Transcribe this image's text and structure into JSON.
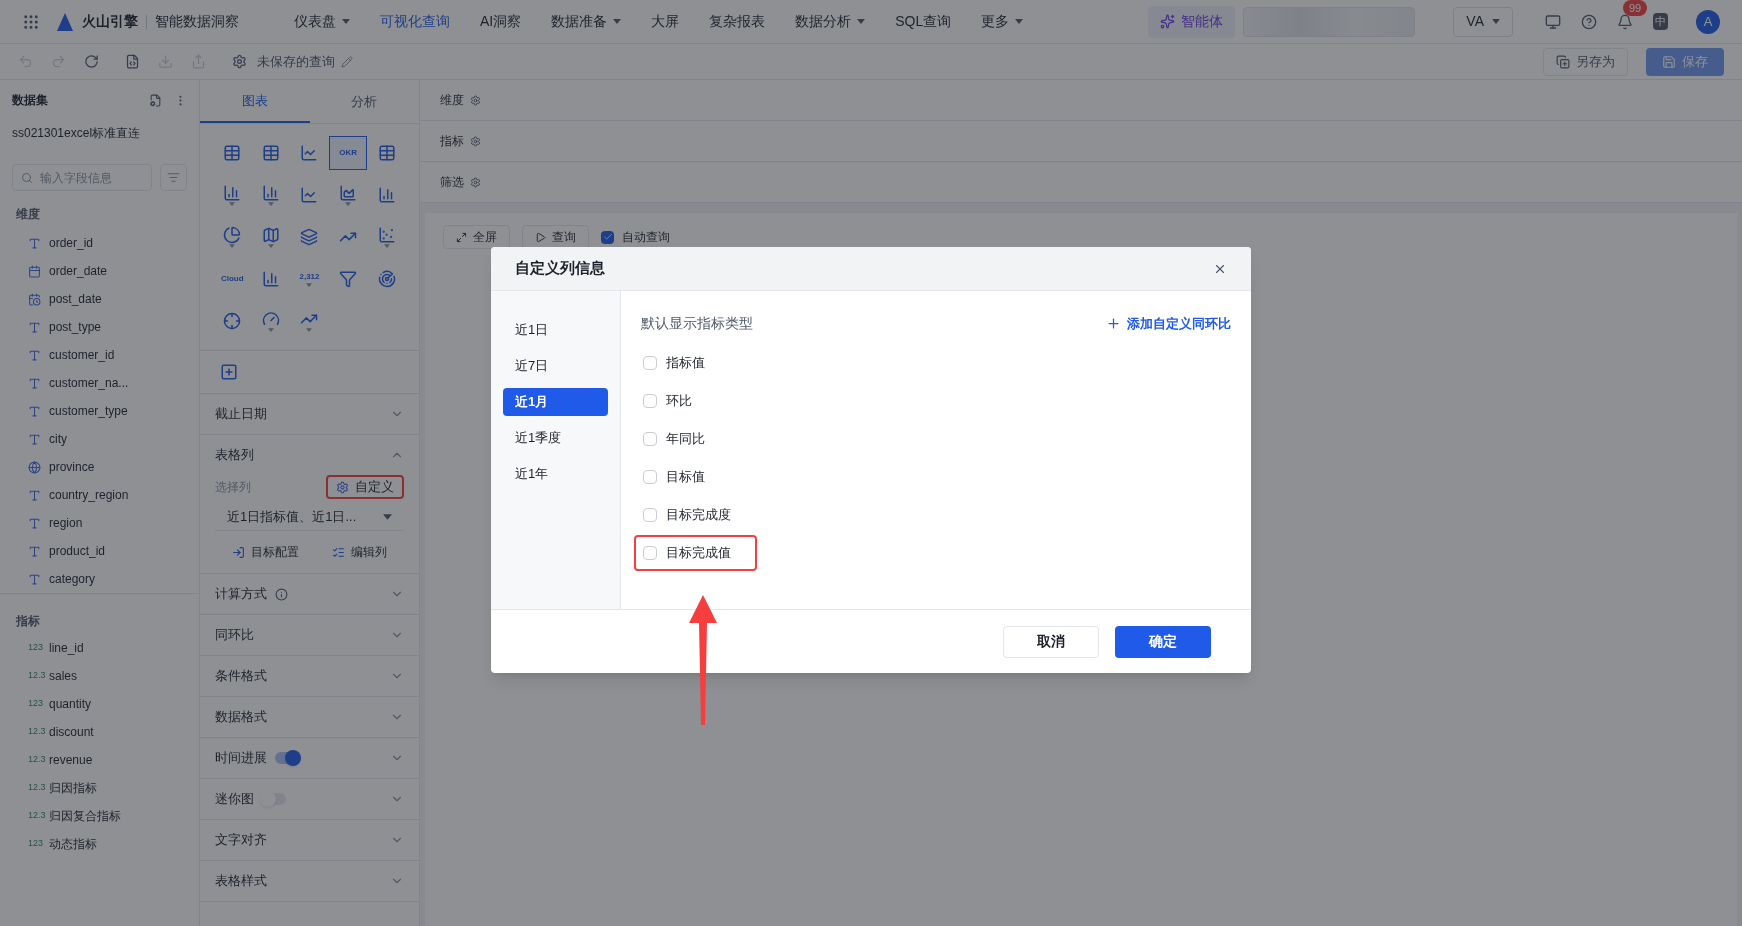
{
  "topbar": {
    "brand": "火山引擎",
    "product": "智能数据洞察",
    "nav": [
      {
        "label": "仪表盘",
        "dropdown": true,
        "selected": false
      },
      {
        "label": "可视化查询",
        "dropdown": false,
        "selected": true
      },
      {
        "label": "AI洞察",
        "dropdown": false,
        "selected": false
      },
      {
        "label": "数据准备",
        "dropdown": true,
        "selected": false
      },
      {
        "label": "大屏",
        "dropdown": false,
        "selected": false
      },
      {
        "label": "复杂报表",
        "dropdown": false,
        "selected": false
      },
      {
        "label": "数据分析",
        "dropdown": true,
        "selected": false
      },
      {
        "label": "SQL查询",
        "dropdown": false,
        "selected": false
      },
      {
        "label": "更多",
        "dropdown": true,
        "selected": false
      }
    ],
    "agent": "智能体",
    "user_menu": "VA",
    "badge": "99",
    "language": "中",
    "avatar": "A"
  },
  "toolbar": {
    "title": "未保存的查询",
    "save_as": "另存为",
    "save": "保存"
  },
  "dataset_panel": {
    "title": "数据集",
    "dataset": "ss021301excel标准直连",
    "search": {
      "placeholder": "输入字段信息"
    },
    "dimensions": {
      "title": "维度",
      "fields": [
        {
          "name": "order_id",
          "kind": "text"
        },
        {
          "name": "order_date",
          "kind": "date"
        },
        {
          "name": "post_date",
          "kind": "datetime"
        },
        {
          "name": "post_type",
          "kind": "text"
        },
        {
          "name": "customer_id",
          "kind": "text"
        },
        {
          "name": "customer_na...",
          "kind": "text"
        },
        {
          "name": "customer_type",
          "kind": "text"
        },
        {
          "name": "city",
          "kind": "text"
        },
        {
          "name": "province",
          "kind": "geo"
        },
        {
          "name": "country_region",
          "kind": "text"
        },
        {
          "name": "region",
          "kind": "text"
        },
        {
          "name": "product_id",
          "kind": "text"
        },
        {
          "name": "category",
          "kind": "text"
        }
      ]
    },
    "measures": {
      "title": "指标",
      "fields": [
        {
          "name": "line_id",
          "type": "123"
        },
        {
          "name": "sales",
          "type": "12.3"
        },
        {
          "name": "quantity",
          "type": "123"
        },
        {
          "name": "discount",
          "type": "12.3"
        },
        {
          "name": "revenue",
          "type": "12.3"
        },
        {
          "name": "归因指标",
          "type": "12.3"
        },
        {
          "name": "归因复合指标",
          "type": "12.3"
        },
        {
          "name": "动态指标",
          "type": "123"
        }
      ]
    }
  },
  "config_panel": {
    "tabs": [
      {
        "label": "图表",
        "selected": true
      },
      {
        "label": "分析",
        "selected": false
      }
    ],
    "chart_types": [
      {
        "selected": false,
        "menu": false
      },
      {
        "selected": false,
        "menu": false
      },
      {
        "selected": false,
        "menu": false
      },
      {
        "selected": true,
        "menu": false,
        "label": "OKR"
      },
      {
        "selected": false,
        "menu": false
      },
      {
        "selected": false,
        "menu": true
      },
      {
        "selected": false,
        "menu": true
      },
      {
        "selected": false,
        "menu": false
      },
      {
        "selected": false,
        "menu": true
      },
      {
        "selected": false,
        "menu": false
      },
      {
        "selected": false,
        "menu": true
      },
      {
        "selected": false,
        "menu": true
      },
      {
        "selected": false,
        "menu": false
      },
      {
        "selected": false,
        "menu": false
      },
      {
        "selected": false,
        "menu": true
      },
      {
        "selected": false,
        "menu": false,
        "label": "Cloud"
      },
      {
        "selected": false,
        "menu": false
      },
      {
        "selected": false,
        "menu": true,
        "label": "2,312"
      },
      {
        "selected": false,
        "menu": false
      },
      {
        "selected": false,
        "menu": false
      },
      {
        "selected": false,
        "menu": false
      },
      {
        "selected": false,
        "menu": true
      },
      {
        "selected": false,
        "menu": true
      }
    ],
    "sections": [
      {
        "kind": "plain",
        "title": "截止日期",
        "expanded": false
      },
      {
        "kind": "columns",
        "title": "表格列",
        "expanded": true,
        "field_label": "选择列",
        "custom_button": "自定义",
        "custom_highlighted": true,
        "select_value": "近1日指标值、近1日...",
        "target_button": "目标配置",
        "edit_button": "编辑列"
      },
      {
        "kind": "info",
        "title": "计算方式",
        "expanded": false
      },
      {
        "kind": "plain",
        "title": "同环比",
        "expanded": false
      },
      {
        "kind": "plain",
        "title": "条件格式",
        "expanded": false
      },
      {
        "kind": "plain",
        "title": "数据格式",
        "expanded": false
      },
      {
        "kind": "toggle",
        "title": "时间进展",
        "expanded": false,
        "on": true
      },
      {
        "kind": "toggle",
        "title": "迷你图",
        "expanded": false,
        "on": false
      },
      {
        "kind": "plain",
        "title": "文字对齐",
        "expanded": false
      },
      {
        "kind": "plain",
        "title": "表格样式",
        "expanded": false
      }
    ]
  },
  "query_area": {
    "shelves": [
      "维度",
      "指标",
      "筛选"
    ],
    "fullscreen": "全屏",
    "run": "查询",
    "auto_query": {
      "label": "自动查询",
      "checked": true
    }
  },
  "dialog": {
    "title": "自定义列信息",
    "periods": [
      {
        "label": "近1日",
        "selected": false
      },
      {
        "label": "近7日",
        "selected": false
      },
      {
        "label": "近1月",
        "selected": true
      },
      {
        "label": "近1季度",
        "selected": false
      },
      {
        "label": "近1年",
        "selected": false
      }
    ],
    "heading": "默认显示指标类型",
    "add_link": "添加自定义同环比",
    "options": [
      {
        "label": "指标值",
        "checked": false,
        "highlighted": false
      },
      {
        "label": "环比",
        "checked": false,
        "highlighted": false
      },
      {
        "label": "年同比",
        "checked": false,
        "highlighted": false
      },
      {
        "label": "目标值",
        "checked": false,
        "highlighted": false
      },
      {
        "label": "目标完成度",
        "checked": false,
        "highlighted": false
      },
      {
        "label": "目标完成值",
        "checked": false,
        "highlighted": true
      }
    ],
    "cancel": "取消",
    "confirm": "确定"
  }
}
